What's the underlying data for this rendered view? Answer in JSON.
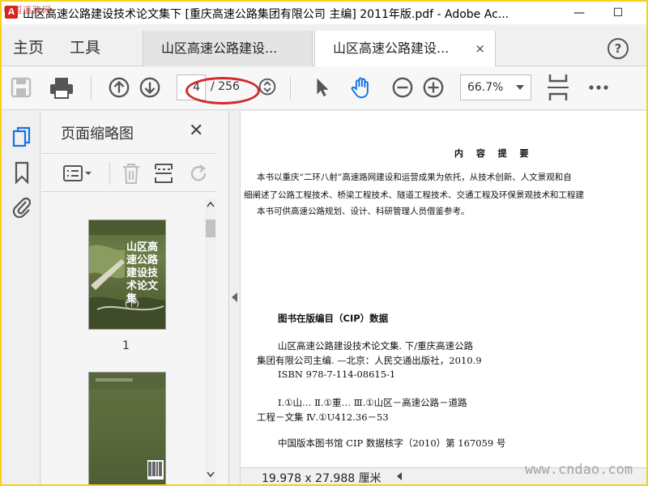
{
  "titlebar": {
    "title": "山区高速公路建设技术论文集下 [重庆高速公路集团有限公司 主编] 2011年版.pdf - Adobe Ac...",
    "watermark": "中国道路网",
    "minimize": "—",
    "maximize": "☐"
  },
  "nav": {
    "home": "主页",
    "tools": "工具",
    "tabs": [
      {
        "label": "山区高速公路建设...",
        "active": false
      },
      {
        "label": "山区高速公路建设...",
        "active": true
      }
    ],
    "tab_close": "×",
    "help": "?"
  },
  "toolbar": {
    "current_page": "4",
    "total_pages": "/ 256",
    "zoom": "66.7%"
  },
  "thumbnail_panel": {
    "title": "页面缩略图",
    "close": "✕",
    "thumbnails": [
      {
        "number": "1",
        "title": "山区高速公路建设技术论文集",
        "sub": "(下)"
      }
    ]
  },
  "document": {
    "heading": "内 容 提 要",
    "paragraphs": [
      "本书以重庆“二环八射”高速路网建设和运营成果为依托，从技术创新、人文景观和自",
      "细阐述了公路工程技术、桥梁工程技术、隧道工程技术、交通工程及环保景观技术和工程建",
      "本书可供高速公路规划、设计、科研管理人员借鉴参考。"
    ],
    "cip_heading": "图书在版编目（CIP）数据",
    "cip_lines": [
      "山区高速公路建设技术论文集. 下/重庆高速公路",
      "集团有限公司主编. —北京：人民交通出版社，2010.9",
      "ISBN 978-7-114-08615-1",
      "Ⅰ.①山…  Ⅱ.①重…  Ⅲ.①山区－高速公路－道路",
      "工程－文集  Ⅳ.①U412.36－53",
      "中国版本图书馆 CIP 数据核字（2010）第 167059 号"
    ]
  },
  "status": {
    "dimensions": "19.978 x 27.988 厘米",
    "watermark": "www.cndao.com"
  }
}
